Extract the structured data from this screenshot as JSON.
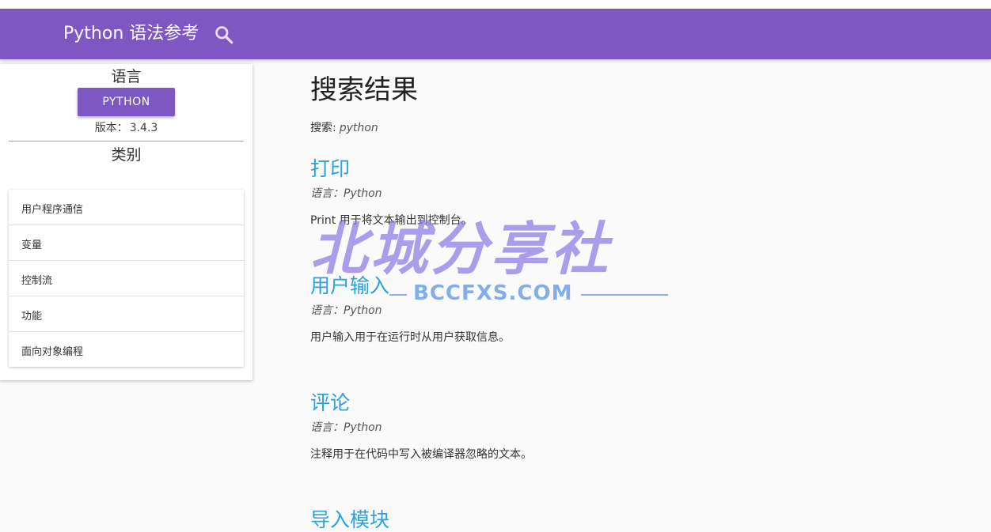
{
  "header": {
    "title": "Python 语法参考"
  },
  "sidebar": {
    "language_heading": "语言",
    "language_button": "PYTHON",
    "version_label": "版本：",
    "version_value": "3.4.3",
    "category_heading": "类别",
    "categories": [
      "用户程序通信",
      "变量",
      "控制流",
      "功能",
      "面向对象编程"
    ]
  },
  "main": {
    "page_title": "搜索结果",
    "search_label": "搜索:",
    "search_query": "python",
    "results": [
      {
        "title": "打印",
        "language": "语言：Python",
        "description": "Print 用于将文本输出到控制台。"
      },
      {
        "title": "用户输入",
        "language": "语言：Python",
        "description": "用户输入用于在运行时从用户获取信息。"
      },
      {
        "title": "评论",
        "language": "语言：Python",
        "description": "注释用于在代码中写入被编译器忽略的文本。"
      },
      {
        "title": "导入模块",
        "language": "",
        "description": ""
      }
    ]
  },
  "watermark": {
    "main": "北城分享社",
    "sub": "BCCFXS.COM"
  },
  "colors": {
    "brand": "#7e57c2",
    "link": "#29a3d9",
    "background": "#fafafa"
  },
  "icons": {
    "search": "search-icon"
  }
}
